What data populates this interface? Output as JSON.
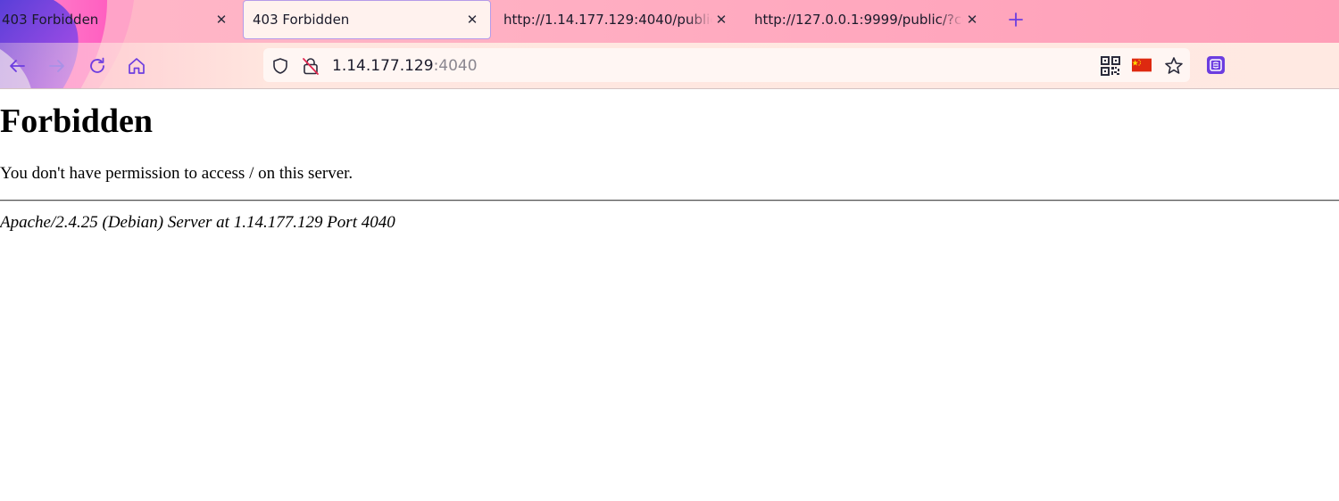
{
  "browser": {
    "tabs": [
      {
        "title": "403 Forbidden",
        "active": false
      },
      {
        "title": "403 Forbidden",
        "active": true
      },
      {
        "title": "http://1.14.177.129:4040/public/?",
        "active": false
      },
      {
        "title": "http://127.0.0.1:9999/public/?coo",
        "active": false
      }
    ],
    "new_tab_icon": "plus-icon",
    "urlbar": {
      "host": "1.14.177.129",
      "port": ":4040"
    },
    "colors": {
      "accent": "#6c3de0",
      "chrome_pink": "#ffb2c4",
      "flag_red": "#de2910",
      "flag_yellow": "#ffde00"
    }
  },
  "page": {
    "heading": "Forbidden",
    "message": "You don't have permission to access / on this server.",
    "server_signature": "Apache/2.4.25 (Debian) Server at 1.14.177.129 Port 4040"
  }
}
